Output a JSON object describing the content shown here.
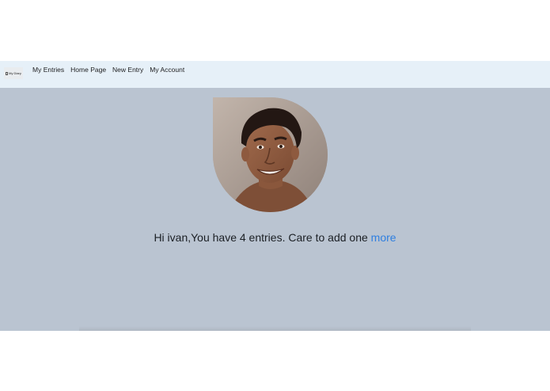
{
  "navbar": {
    "brand_label": "My Diary",
    "links": [
      {
        "label": "My Entries"
      },
      {
        "label": "Home Page"
      },
      {
        "label": "New Entry"
      },
      {
        "label": "My Account"
      }
    ]
  },
  "main": {
    "greeting_prefix": "Hi ivan,You have 4 entries. Care to add one ",
    "more_link": "more"
  },
  "colors": {
    "navbar_bg": "#e6f0f8",
    "main_bg": "#bac4d1",
    "link_accent": "#2f7fe0"
  }
}
